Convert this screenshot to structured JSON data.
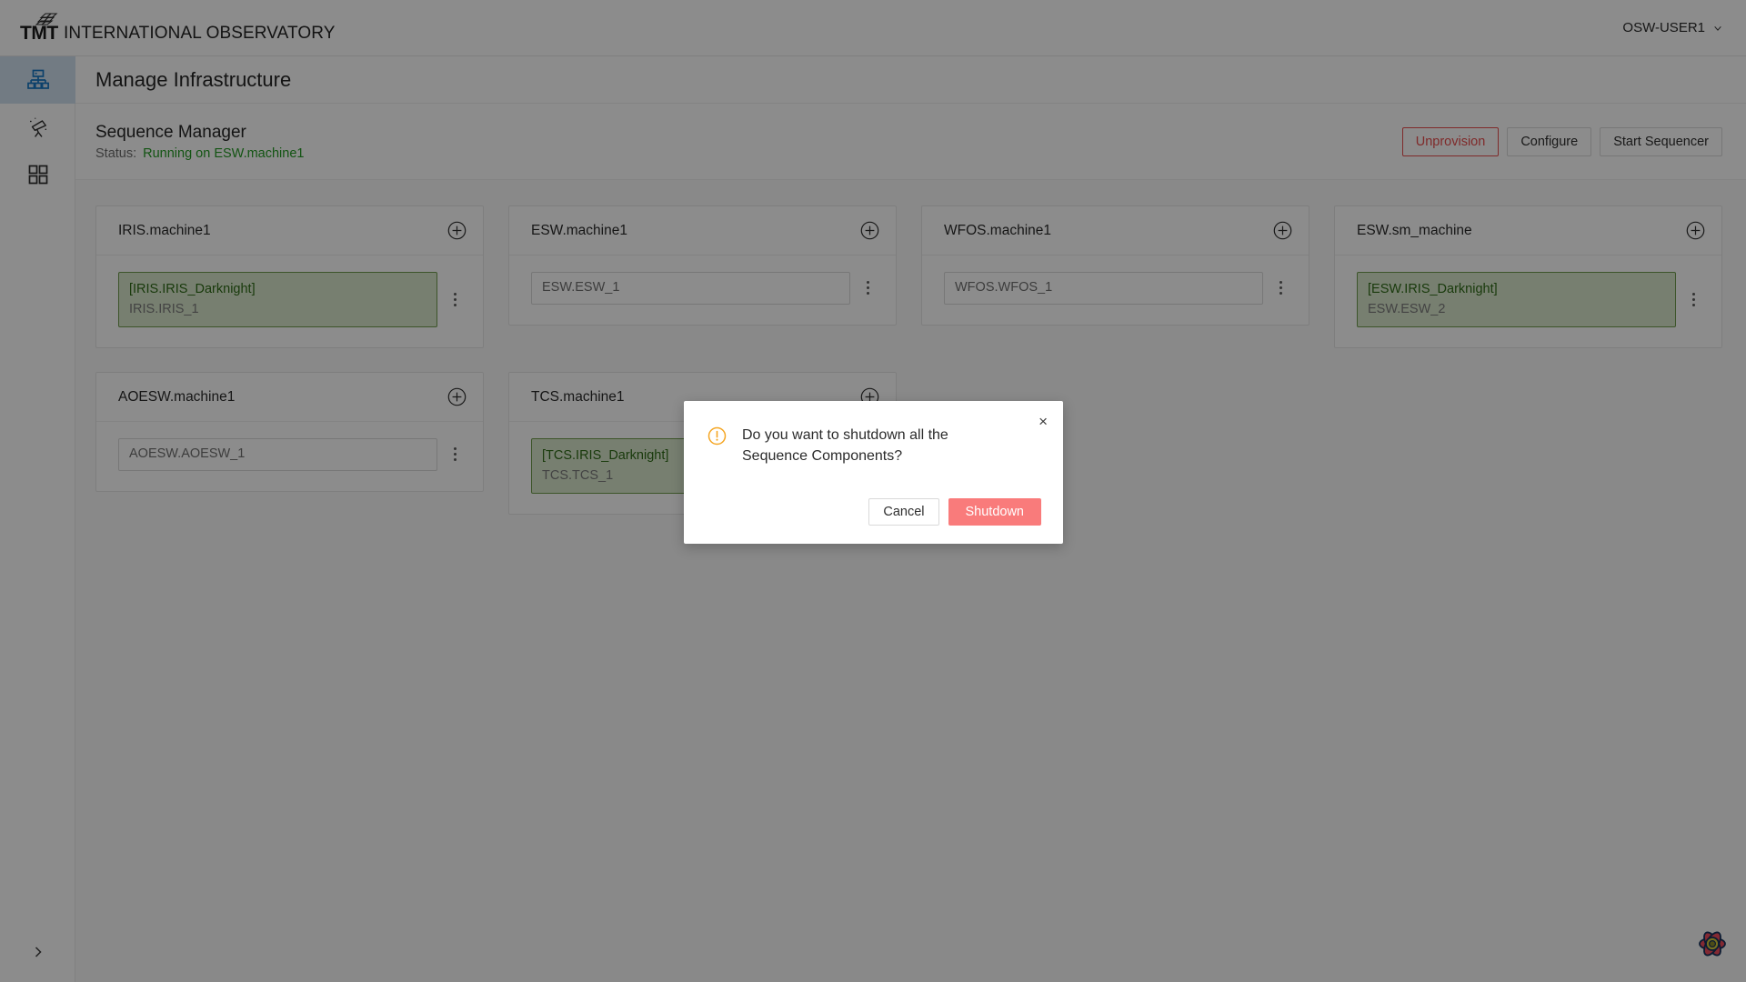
{
  "header": {
    "brand_abbr": "TMT",
    "brand_name": "INTERNATIONAL OBSERVATORY",
    "user": "OSW-USER1",
    "user_chevron_icon": "chevron-down-icon"
  },
  "sidebar": {
    "items": [
      {
        "icon": "sitemap-icon",
        "name": "manage-infrastructure",
        "active": true
      },
      {
        "icon": "telescope-icon",
        "name": "observe",
        "active": false
      },
      {
        "icon": "grid-apps-icon",
        "name": "resources",
        "active": false
      }
    ],
    "expand_icon": "chevron-right-icon"
  },
  "page": {
    "title": "Manage Infrastructure"
  },
  "sequence_manager": {
    "name": "Sequence Manager",
    "status_label": "Status:",
    "status_value": "Running on ESW.machine1",
    "status_color": "#239a23",
    "actions": [
      {
        "label": "Unprovision",
        "variant": "danger",
        "color": "#e84d4d"
      },
      {
        "label": "Configure",
        "variant": "default"
      },
      {
        "label": "Start Sequencer",
        "variant": "default"
      }
    ]
  },
  "machines": [
    {
      "title": "IRIS.machine1",
      "add_icon": "plus-circle-icon",
      "components": [
        {
          "sequencer": "[IRIS.IRIS_Darknight]",
          "name": "IRIS.IRIS_1",
          "loaded": true
        }
      ]
    },
    {
      "title": "ESW.machine1",
      "add_icon": "plus-circle-icon",
      "components": [
        {
          "sequencer": "",
          "name": "ESW.ESW_1",
          "loaded": false
        }
      ]
    },
    {
      "title": "WFOS.machine1",
      "add_icon": "plus-circle-icon",
      "components": [
        {
          "sequencer": "",
          "name": "WFOS.WFOS_1",
          "loaded": false
        }
      ]
    },
    {
      "title": "ESW.sm_machine",
      "add_icon": "plus-circle-icon",
      "components": [
        {
          "sequencer": "[ESW.IRIS_Darknight]",
          "name": "ESW.ESW_2",
          "loaded": true
        }
      ]
    },
    {
      "title": "AOESW.machine1",
      "add_icon": "plus-circle-icon",
      "components": [
        {
          "sequencer": "",
          "name": "AOESW.AOESW_1",
          "loaded": false
        }
      ]
    },
    {
      "title": "TCS.machine1",
      "add_icon": "plus-circle-icon",
      "components": [
        {
          "sequencer": "[TCS.IRIS_Darknight]",
          "name": "TCS.TCS_1",
          "loaded": true
        }
      ]
    }
  ],
  "modal": {
    "warning_icon": "exclamation-circle-icon",
    "warning_color": "#f5a623",
    "message": "Do you want to shutdown all the Sequence Components?",
    "close_label": "×",
    "close_icon": "close-icon",
    "cancel_label": "Cancel",
    "confirm_label": "Shutdown",
    "confirm_color": "#f97b7b"
  },
  "devtools": {
    "icon": "react-query-logo-icon"
  }
}
